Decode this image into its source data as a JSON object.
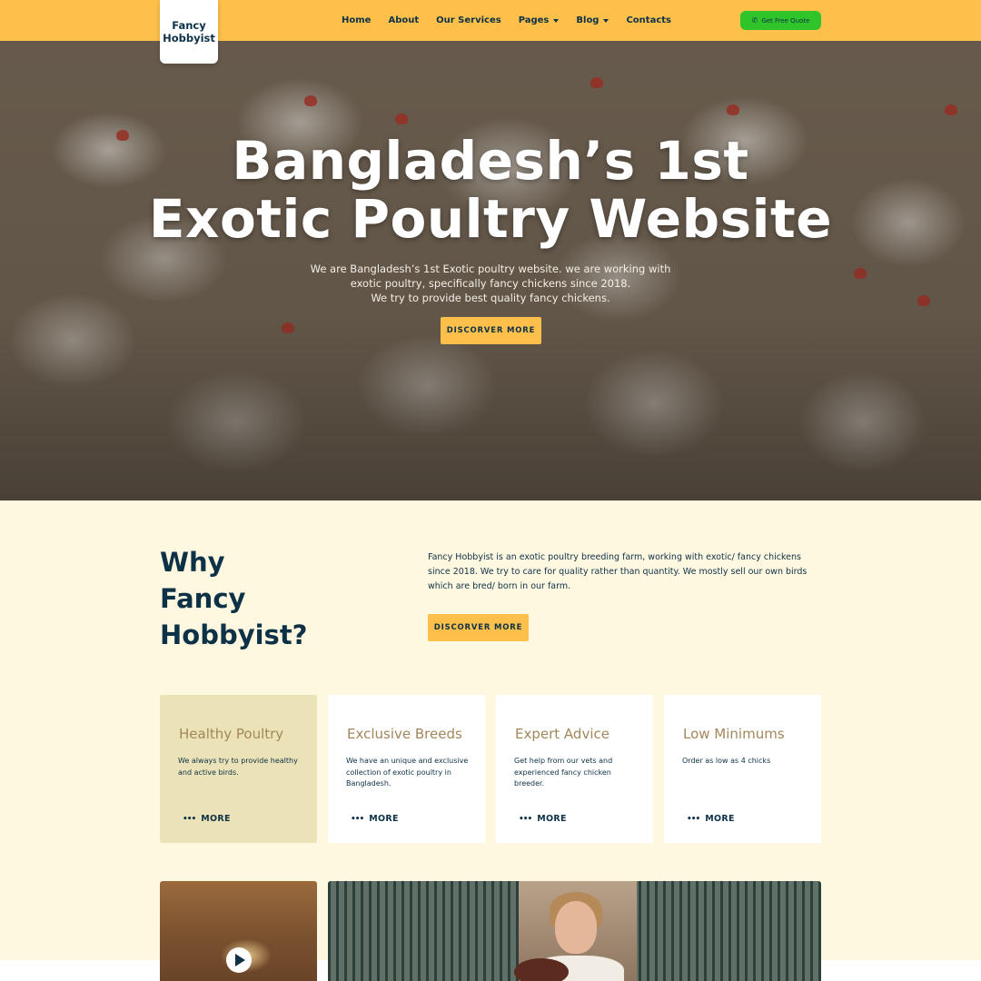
{
  "header": {
    "logo_text": "Fancy Hobbyist",
    "nav": [
      {
        "label": "Home",
        "dropdown": false
      },
      {
        "label": "About",
        "dropdown": false
      },
      {
        "label": "Our Services",
        "dropdown": false
      },
      {
        "label": "Pages",
        "dropdown": true
      },
      {
        "label": "Blog",
        "dropdown": true
      },
      {
        "label": "Contacts",
        "dropdown": false
      }
    ],
    "quote_button": "Get Free Quote",
    "quote_icon": "phone-icon",
    "bg_color": "#fec04a",
    "quote_color": "#2fc52a"
  },
  "hero": {
    "title_line1": "Bangladesh’s 1st",
    "title_line2": "Exotic Poultry Website",
    "subtitle_line1": "We are Bangladesh’s 1st Exotic poultry website. we are working with",
    "subtitle_line2": "exotic poultry, specifically fancy chickens since 2018.",
    "subtitle_line3": "We try to provide best quality fancy chickens.",
    "button": "DISCORVER MORE"
  },
  "why": {
    "title_line1": "Why",
    "title_line2": "Fancy",
    "title_line3": "Hobbyist?",
    "text": "Fancy Hobbyist is an exotic poultry breeding farm, working with exotic/ fancy chickens since 2018. We try to care for quality rather than quantity. We mostly sell our own birds which are bred/ born in our farm.",
    "button": "DISCORVER MORE"
  },
  "cards": [
    {
      "title": "Healthy Poultry",
      "desc": "We always try to provide healthy and active birds.",
      "more": "MORE",
      "active": true
    },
    {
      "title": "Exclusive Breeds",
      "desc": "We have an unique and exclusive collection of exotic poultry in Bangladesh.",
      "more": "MORE",
      "active": false
    },
    {
      "title": "Expert Advice",
      "desc": "Get help from our vets and experienced fancy chicken breeder.",
      "more": "MORE",
      "active": false
    },
    {
      "title": "Low Minimums",
      "desc": "Order as low as 4 chicks",
      "more": "MORE",
      "active": false
    }
  ],
  "media": {
    "play_icon": "play-icon"
  },
  "colors": {
    "accent": "#fec04a",
    "navy": "#0d3147",
    "card_title": "#a2875a",
    "page_bg": "#fff8e1"
  }
}
